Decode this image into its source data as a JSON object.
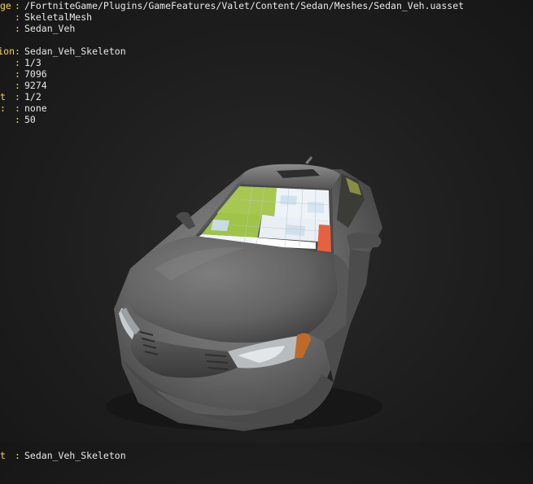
{
  "overlay": {
    "rows": [
      {
        "key": "ge",
        "value": "/FortniteGame/Plugins/GameFeatures/Valet/Content/Sedan/Meshes/Sedan_Veh.uasset"
      },
      {
        "key": "",
        "value": "SkeletalMesh"
      },
      {
        "key": "",
        "value": "Sedan_Veh"
      },
      {
        "key": "ion",
        "value": "Sedan_Veh_Skeleton"
      },
      {
        "key": "",
        "value": "1/3"
      },
      {
        "key": "",
        "value": "7096"
      },
      {
        "key": "",
        "value": "9274"
      },
      {
        "key": "t",
        "value": "1/2"
      },
      {
        "key": ":",
        "value": "none"
      },
      {
        "key": "",
        "value": "50"
      }
    ],
    "separator": ":"
  },
  "bottom_overlay": {
    "key": "t",
    "value": "Sedan_Veh_Skeleton"
  },
  "viewport": {
    "subject": "sedan-vehicle-mesh",
    "colors": {
      "background": "#1e1e1e",
      "key_text": "#f6d84a",
      "value_text": "#e8e8e8",
      "car_body": "#6b6b6b",
      "windshield_green": "#9fc44a",
      "windshield_white": "#f0f4f7",
      "windshield_orange": "#e8644a"
    }
  }
}
